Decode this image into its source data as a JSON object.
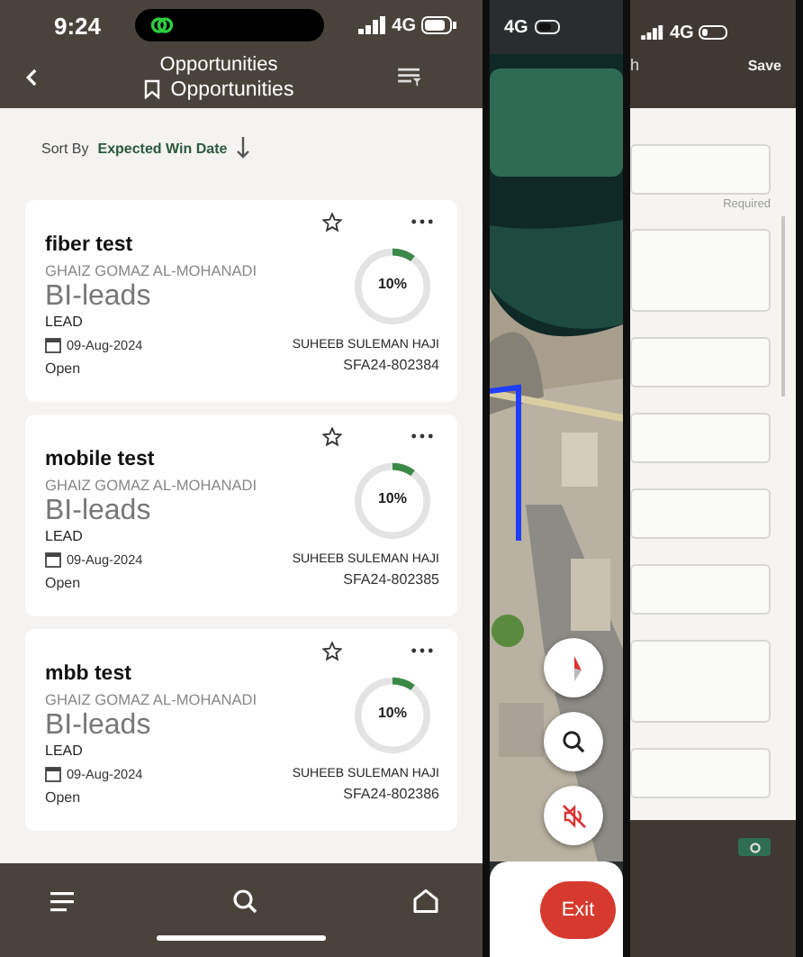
{
  "status_bar": {
    "time": "9:24",
    "network": "4G"
  },
  "header": {
    "title": "Opportunities",
    "subtitle": "Opportunities"
  },
  "sort": {
    "label": "Sort By",
    "value": "Expected Win Date"
  },
  "opportunities": [
    {
      "name": "fiber test",
      "account": "GHAIZ GOMAZ AL-MOHANADI",
      "source": "BI-leads",
      "type": "LEAD",
      "date": "09-Aug-2024",
      "status": "Open",
      "level": 0.1,
      "percent": "10%",
      "owner": "SUHEEB SULEMAN HAJI",
      "number": "SFA24-802384",
      "favorite": false
    },
    {
      "name": "mobile test",
      "account": "GHAIZ GOMAZ AL-MOHANADI",
      "source": "BI-leads",
      "type": "LEAD",
      "date": "09-Aug-2024",
      "status": "Open",
      "level": 0.1,
      "percent": "10%",
      "owner": "SUHEEB SULEMAN HAJI",
      "number": "SFA24-802385",
      "favorite": false
    },
    {
      "name": "mbb test",
      "account": "GHAIZ GOMAZ AL-MOHANADI",
      "source": "BI-leads",
      "type": "LEAD",
      "date": "09-Aug-2024",
      "status": "Open",
      "level": 0.1,
      "percent": "10%",
      "owner": "SUHEEB SULEMAN HAJI",
      "number": "SFA24-802386",
      "favorite": false
    }
  ],
  "map_screen": {
    "network": "4G",
    "exit": "Exit"
  },
  "form_screen": {
    "network": "4G",
    "header_left": "h",
    "save": "Save",
    "hint": "Required"
  }
}
